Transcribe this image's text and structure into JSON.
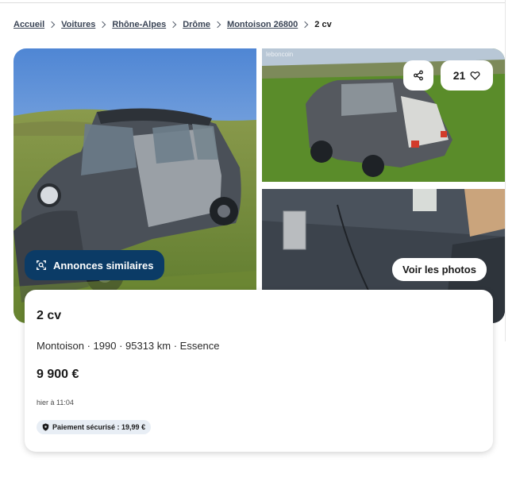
{
  "breadcrumb": {
    "items": [
      "Accueil",
      "Voitures",
      "Rhône-Alpes",
      "Drôme",
      "Montoison 26800"
    ],
    "current": "2 cv"
  },
  "gallery": {
    "similar_label": "Annonces similaires",
    "favorites_count": "21",
    "see_photos_label": "Voir les photos",
    "watermark": "leboncoin"
  },
  "listing": {
    "title": "2 cv",
    "details": "Montoison · 1990 · 95313 km · Essence",
    "price": "9 900 €",
    "posted": "hier à 11:04",
    "secure_payment": "Paiement sécurisé : 19,99 €"
  },
  "colors": {
    "brand_dark": "#0b3b66",
    "badge_bg": "#e8eef5"
  },
  "icons": [
    "chevron-right-icon",
    "similar-search-icon",
    "share-icon",
    "heart-icon",
    "shield-icon"
  ]
}
